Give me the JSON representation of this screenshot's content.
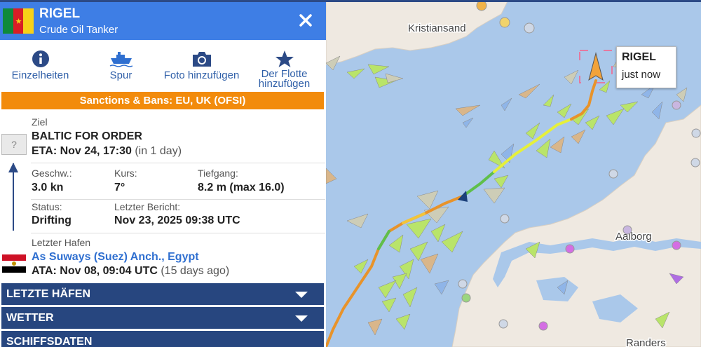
{
  "vessel": {
    "name": "RIGEL",
    "type": "Crude Oil Tanker",
    "flag_icon": "cameroon-flag",
    "map_label_name": "RIGEL",
    "map_label_time": "just now"
  },
  "actions": [
    {
      "icon": "info-icon",
      "label": "Einzelheiten"
    },
    {
      "icon": "ship-track-icon",
      "label": "Spur"
    },
    {
      "icon": "camera-icon",
      "label": "Foto hinzufügen"
    },
    {
      "icon": "star-icon",
      "label_line1": "Der Flotte",
      "label_line2": "hinzufügen"
    }
  ],
  "sanctions": "Sanctions & Bans: EU, UK (OFSI)",
  "destination": {
    "label": "Ziel",
    "value": "BALTIC FOR ORDER",
    "eta": "ETA: Nov 24, 17:30",
    "eta_relative": "(in 1 day)",
    "unknown_port": "?"
  },
  "stats": {
    "speed_label": "Geschw.:",
    "speed": "3.0 kn",
    "course_label": "Kurs:",
    "course": "7°",
    "draught_label": "Tiefgang:",
    "draught": "8.2 m (max 16.0)",
    "status_label": "Status:",
    "status": "Drifting",
    "report_label": "Letzter Bericht:",
    "report": "Nov 23, 2025 09:38 UTC"
  },
  "last_port": {
    "label": "Letzter Hafen",
    "name": "As Suways (Suez) Anch., Egypt",
    "ata": "ATA: Nov 08, 09:04 UTC",
    "ata_relative": "(15 days ago)",
    "flag_icon": "egypt-flag"
  },
  "accordions": [
    "LETZTE HÄFEN",
    "WETTER",
    "SCHIFFSDATEN"
  ],
  "map": {
    "places": [
      "Kristiansand",
      "Aalborg",
      "Randers"
    ]
  },
  "colors": {
    "header": "#3e7ee5",
    "sanctions": "#f28b0c",
    "accordion": "#27467f",
    "sea": "#aac8ea",
    "land": "#efe9e1"
  }
}
